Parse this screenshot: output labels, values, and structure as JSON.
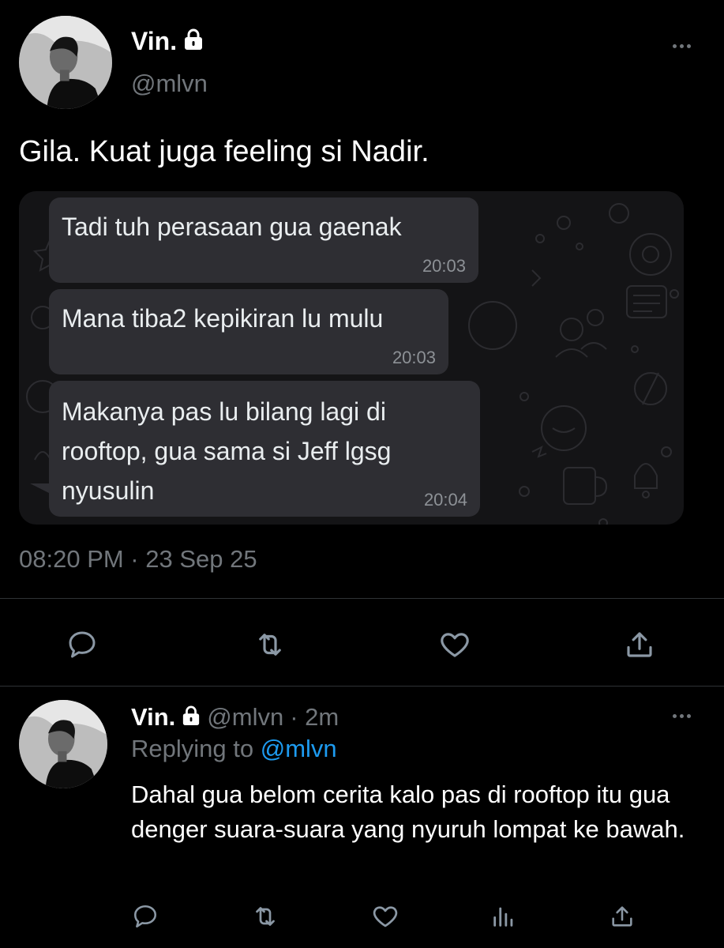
{
  "main_tweet": {
    "display_name": "Vin.",
    "handle": "@mlvn",
    "text": "Gila. Kuat juga feeling si Nadir.",
    "timestamp": "08:20 PM · 23 Sep 25",
    "chat": [
      {
        "text": "Tadi tuh perasaan gua gaenak",
        "time": "20:03"
      },
      {
        "text": "Mana tiba2 kepikiran lu mulu",
        "time": "20:03"
      },
      {
        "text": "Makanya pas lu bilang lagi di rooftop, gua sama si Jeff lgsg nyusulin",
        "time": "20:04"
      }
    ],
    "actions": [
      "reply-icon",
      "retweet-icon",
      "like-icon",
      "share-icon"
    ]
  },
  "reply_tweet": {
    "display_name": "Vin.",
    "handle": "@mlvn",
    "age": "· 2m",
    "replying_label": "Replying to",
    "replying_handle": "@mlvn",
    "text": "Dahal gua belom cerita kalo pas di rooftop itu gua denger suara-suara yang nyuruh lompat ke bawah.",
    "actions": [
      "reply-icon",
      "retweet-icon",
      "like-icon",
      "views-icon",
      "share-icon"
    ]
  },
  "colors": {
    "background": "#000000",
    "muted": "#71767b",
    "link": "#1d9bf0",
    "bubble": "#2e2e33"
  }
}
